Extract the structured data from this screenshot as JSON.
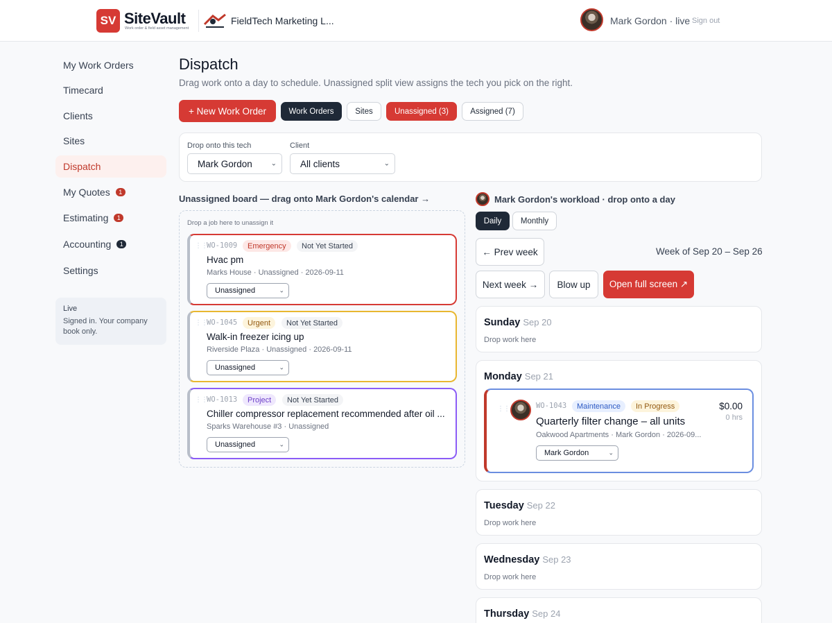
{
  "header": {
    "logo_mark": "SV",
    "app_name": "SiteVault",
    "tagline": "Work order & field asset management",
    "company_name": "FieldTech Marketing L...",
    "user_label": "Mark Gordon · live",
    "signout_label": "Sign out"
  },
  "sidebar": {
    "items": [
      {
        "label": "My Work Orders"
      },
      {
        "label": "Timecard"
      },
      {
        "label": "Clients"
      },
      {
        "label": "Sites"
      },
      {
        "label": "Dispatch"
      },
      {
        "label": "My Quotes",
        "badge": "1"
      },
      {
        "label": "Estimating",
        "badge": "1"
      },
      {
        "label": "Accounting",
        "badge": "1"
      },
      {
        "label": "Settings"
      }
    ],
    "live_title": "Live",
    "live_text": "Signed in. Your company book only."
  },
  "page": {
    "title": "Dispatch",
    "subtitle": "Drag work onto a day to schedule. Unassigned split view assigns the tech you pick on the right."
  },
  "toolbar": {
    "new_wo": "+ New Work Order",
    "work_orders": "Work Orders",
    "sites": "Sites",
    "unassigned": "Unassigned (3)",
    "assigned": "Assigned (7)"
  },
  "filters": {
    "tech_label": "Drop onto this tech",
    "tech_value": "Mark Gordon",
    "client_label": "Client",
    "client_value": "All clients"
  },
  "unassigned_board": {
    "title": "Unassigned board — drag onto Mark Gordon's calendar →",
    "hint": "Drop a job here to unassign it",
    "cards": [
      {
        "id": "WO-1009",
        "priority": "Emergency",
        "status": "Not Yet Started",
        "title": "Hvac pm",
        "meta": "Marks House · Unassigned · 2026-09-11",
        "assignee": "Unassigned",
        "accent": "#d63a34"
      },
      {
        "id": "WO-1045",
        "priority": "Urgent",
        "status": "Not Yet Started",
        "title": "Walk-in freezer icing up",
        "meta": "Riverside Plaza · Unassigned · 2026-09-11",
        "assignee": "Unassigned",
        "accent": "#e8b730"
      },
      {
        "id": "WO-1013",
        "priority": "Project",
        "status": "Not Yet Started",
        "title": "Chiller compressor replacement recommended after oil ...",
        "meta": "Sparks Warehouse #3 · Unassigned",
        "assignee": "Unassigned",
        "accent": "#8b5cf6"
      }
    ]
  },
  "workload": {
    "title": "Mark Gordon's workload · drop onto a day",
    "view_daily": "Daily",
    "view_monthly": "Monthly",
    "prev_week": "← Prev week",
    "week_label": "Week of Sep 20 – Sep 26",
    "next_week": "Next week →",
    "blow_up": "Blow up",
    "full_screen": "Open full screen ↗",
    "drop_text": "Drop work here",
    "days": [
      {
        "name": "Sunday",
        "date": "Sep 20"
      },
      {
        "name": "Monday",
        "date": "Sep 21"
      },
      {
        "name": "Tuesday",
        "date": "Sep 22"
      },
      {
        "name": "Wednesday",
        "date": "Sep 23"
      },
      {
        "name": "Thursday",
        "date": "Sep 24"
      }
    ],
    "scheduled": {
      "id": "WO-1043",
      "category": "Maintenance",
      "status": "In Progress",
      "title": "Quarterly filter change – all units",
      "meta": "Oakwood Apartments · Mark Gordon · 2026-09...",
      "amount": "$0.00",
      "hours": "0 hrs",
      "assignee": "Mark Gordon"
    }
  },
  "colors": {
    "brand_red": "#d63a34",
    "dark": "#1f2937",
    "urgent_yellow": "#e8b730",
    "project_purple": "#8b5cf6",
    "maintenance_blue": "#6b8ee0"
  }
}
